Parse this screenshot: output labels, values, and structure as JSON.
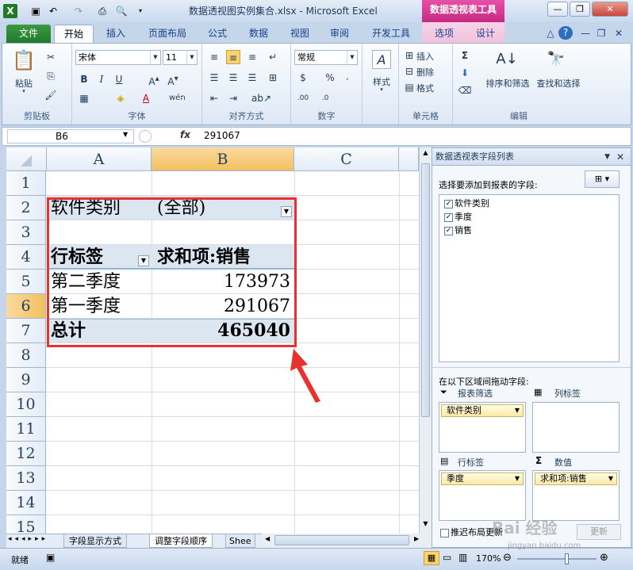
{
  "app": {
    "window_title": "数据透视图实例集合.xlsx - Microsoft Excel",
    "contextual_tab_group": "数据透视表工具"
  },
  "tabs": [
    "文件",
    "开始",
    "插入",
    "页面布局",
    "公式",
    "数据",
    "视图",
    "审阅",
    "开发工具",
    "选项",
    "设计"
  ],
  "ribbon": {
    "clipboard": {
      "label": "剪贴板",
      "paste": "粘贴"
    },
    "font": {
      "label": "字体",
      "family": "宋体",
      "size": "11"
    },
    "alignment": {
      "label": "对齐方式"
    },
    "number": {
      "label": "数字",
      "format": "常规",
      "percent": "%"
    },
    "styles": {
      "label": "样式"
    },
    "cells": {
      "label": "单元格",
      "insert": "插入",
      "delete": "删除",
      "format": "格式"
    },
    "editing": {
      "label": "编辑",
      "sort_filter": "排序和筛选",
      "find_select": "查找和选择"
    }
  },
  "formula_bar": {
    "name_box": "B6",
    "fx": "fx",
    "value": "291067"
  },
  "sheet": {
    "columns": [
      "A",
      "B",
      "C"
    ],
    "rows": [
      "1",
      "2",
      "3",
      "4",
      "5",
      "6",
      "7",
      "8",
      "9",
      "10",
      "11",
      "12",
      "13",
      "14",
      "15"
    ],
    "cells": {
      "a2": "软件类别",
      "b2": "(全部)",
      "a4": "行标签",
      "b4": "求和项:销售",
      "a5": "第二季度",
      "b5": "173973",
      "a6": "第一季度",
      "b6": "291067",
      "a7": "总计",
      "b7": "465040"
    },
    "tabs": [
      "字段显示方式",
      "调整字段顺序",
      "Shee"
    ]
  },
  "status": {
    "ready": "就绪",
    "zoom": "170%"
  },
  "pivot_panel": {
    "title": "数据透视表字段列表",
    "choose_label": "选择要添加到报表的字段:",
    "fields": [
      "软件类别",
      "季度",
      "销售"
    ],
    "drag_label": "在以下区域间拖动字段:",
    "filter_area": "报表筛选",
    "column_area": "列标签",
    "row_area": "行标签",
    "values_area": "数值",
    "filter_item": "软件类别",
    "row_item": "季度",
    "value_item": "求和项:销售",
    "defer_label": "推迟布局更新",
    "update_button": "更新"
  },
  "watermark": {
    "text": "Bai 经验",
    "url": "jingyan.baidu.com"
  }
}
